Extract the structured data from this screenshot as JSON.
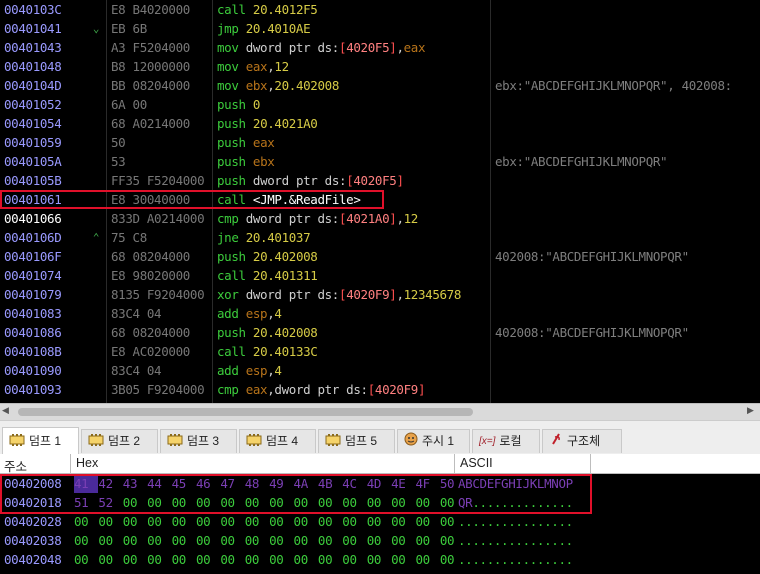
{
  "disasm": {
    "rows": [
      {
        "addr": "0040103C",
        "arrow": "",
        "bytes": "E8 B4020000",
        "instr": [
          {
            "t": "call ",
            "c": "t-mn"
          },
          {
            "t": "20.4012F5",
            "c": "t-num"
          }
        ],
        "comment": ""
      },
      {
        "addr": "00401041",
        "arrow": "⌄",
        "bytes": "EB 6B",
        "instr": [
          {
            "t": "jmp ",
            "c": "t-mn"
          },
          {
            "t": "20.4010AE",
            "c": "t-num"
          }
        ],
        "comment": ""
      },
      {
        "addr": "00401043",
        "arrow": "",
        "bytes": "A3 F5204000",
        "instr": [
          {
            "t": "mov ",
            "c": "t-mn"
          },
          {
            "t": "dword ptr ds:",
            "c": "t-kw"
          },
          {
            "t": "[",
            "c": "t-br"
          },
          {
            "t": "4020F5",
            "c": "t-lbl"
          },
          {
            "t": "]",
            "c": "t-br"
          },
          {
            "t": ",",
            "c": "t-kw"
          },
          {
            "t": "eax",
            "c": "t-reg"
          }
        ],
        "comment": ""
      },
      {
        "addr": "00401048",
        "arrow": "",
        "bytes": "B8 12000000",
        "instr": [
          {
            "t": "mov ",
            "c": "t-mn"
          },
          {
            "t": "eax",
            "c": "t-reg"
          },
          {
            "t": ",",
            "c": "t-kw"
          },
          {
            "t": "12",
            "c": "t-num"
          }
        ],
        "comment": ""
      },
      {
        "addr": "0040104D",
        "arrow": "",
        "bytes": "BB 08204000",
        "instr": [
          {
            "t": "mov ",
            "c": "t-mn"
          },
          {
            "t": "ebx",
            "c": "t-reg"
          },
          {
            "t": ",",
            "c": "t-kw"
          },
          {
            "t": "20.402008",
            "c": "t-num"
          }
        ],
        "comment": "ebx:\"ABCDEFGHIJKLMNOPQR\", 402008:"
      },
      {
        "addr": "00401052",
        "arrow": "",
        "bytes": "6A 00",
        "instr": [
          {
            "t": "push ",
            "c": "t-mn"
          },
          {
            "t": "0",
            "c": "t-num"
          }
        ],
        "comment": ""
      },
      {
        "addr": "00401054",
        "arrow": "",
        "bytes": "68 A0214000",
        "instr": [
          {
            "t": "push ",
            "c": "t-mn"
          },
          {
            "t": "20.4021A0",
            "c": "t-num"
          }
        ],
        "comment": ""
      },
      {
        "addr": "00401059",
        "arrow": "",
        "bytes": "50",
        "instr": [
          {
            "t": "push ",
            "c": "t-mn"
          },
          {
            "t": "eax",
            "c": "t-reg"
          }
        ],
        "comment": ""
      },
      {
        "addr": "0040105A",
        "arrow": "",
        "bytes": "53",
        "instr": [
          {
            "t": "push ",
            "c": "t-mn"
          },
          {
            "t": "ebx",
            "c": "t-reg"
          }
        ],
        "comment": "ebx:\"ABCDEFGHIJKLMNOPQR\""
      },
      {
        "addr": "0040105B",
        "arrow": "",
        "bytes": "FF35 F5204000",
        "instr": [
          {
            "t": "push ",
            "c": "t-mn"
          },
          {
            "t": "dword ptr ds:",
            "c": "t-kw"
          },
          {
            "t": "[",
            "c": "t-br"
          },
          {
            "t": "4020F5",
            "c": "t-lbl"
          },
          {
            "t": "]",
            "c": "t-br"
          }
        ],
        "comment": ""
      },
      {
        "addr": "00401061",
        "arrow": "",
        "bytes": "E8 30040000",
        "instr": [
          {
            "t": "call ",
            "c": "t-mn"
          },
          {
            "t": "<JMP.&ReadFile>",
            "c": "t-api"
          }
        ],
        "comment": "",
        "boxed": true
      },
      {
        "addr": "00401066",
        "arrow": "",
        "bytes": "833D A0214000",
        "instr": [
          {
            "t": "cmp ",
            "c": "t-mn"
          },
          {
            "t": "dword ptr ds:",
            "c": "t-kw"
          },
          {
            "t": "[",
            "c": "t-br"
          },
          {
            "t": "4021A0",
            "c": "t-lbl"
          },
          {
            "t": "]",
            "c": "t-br"
          },
          {
            "t": ",",
            "c": "t-kw"
          },
          {
            "t": "12",
            "c": "t-num"
          }
        ],
        "comment": "",
        "selected": true
      },
      {
        "addr": "0040106D",
        "arrow": "⌃",
        "bytes": "75 C8",
        "instr": [
          {
            "t": "jne ",
            "c": "t-mn"
          },
          {
            "t": "20.401037",
            "c": "t-num"
          }
        ],
        "comment": ""
      },
      {
        "addr": "0040106F",
        "arrow": "",
        "bytes": "68 08204000",
        "instr": [
          {
            "t": "push ",
            "c": "t-mn"
          },
          {
            "t": "20.402008",
            "c": "t-num"
          }
        ],
        "comment": "402008:\"ABCDEFGHIJKLMNOPQR\""
      },
      {
        "addr": "00401074",
        "arrow": "",
        "bytes": "E8 98020000",
        "instr": [
          {
            "t": "call ",
            "c": "t-mn"
          },
          {
            "t": "20.401311",
            "c": "t-num"
          }
        ],
        "comment": ""
      },
      {
        "addr": "00401079",
        "arrow": "",
        "bytes": "8135 F9204000",
        "instr": [
          {
            "t": "xor ",
            "c": "t-mn"
          },
          {
            "t": "dword ptr ds:",
            "c": "t-kw"
          },
          {
            "t": "[",
            "c": "t-br"
          },
          {
            "t": "4020F9",
            "c": "t-lbl"
          },
          {
            "t": "]",
            "c": "t-br"
          },
          {
            "t": ",",
            "c": "t-kw"
          },
          {
            "t": "12345678",
            "c": "t-num"
          }
        ],
        "comment": ""
      },
      {
        "addr": "00401083",
        "arrow": "",
        "bytes": "83C4 04",
        "instr": [
          {
            "t": "add ",
            "c": "t-mn"
          },
          {
            "t": "esp",
            "c": "t-reg"
          },
          {
            "t": ",",
            "c": "t-kw"
          },
          {
            "t": "4",
            "c": "t-num"
          }
        ],
        "comment": ""
      },
      {
        "addr": "00401086",
        "arrow": "",
        "bytes": "68 08204000",
        "instr": [
          {
            "t": "push ",
            "c": "t-mn"
          },
          {
            "t": "20.402008",
            "c": "t-num"
          }
        ],
        "comment": "402008:\"ABCDEFGHIJKLMNOPQR\""
      },
      {
        "addr": "0040108B",
        "arrow": "",
        "bytes": "E8 AC020000",
        "instr": [
          {
            "t": "call ",
            "c": "t-mn"
          },
          {
            "t": "20.40133C",
            "c": "t-num"
          }
        ],
        "comment": ""
      },
      {
        "addr": "00401090",
        "arrow": "",
        "bytes": "83C4 04",
        "instr": [
          {
            "t": "add ",
            "c": "t-mn"
          },
          {
            "t": "esp",
            "c": "t-reg"
          },
          {
            "t": ",",
            "c": "t-kw"
          },
          {
            "t": "4",
            "c": "t-num"
          }
        ],
        "comment": ""
      },
      {
        "addr": "00401093",
        "arrow": "",
        "bytes": "3B05 F9204000",
        "instr": [
          {
            "t": "cmp ",
            "c": "t-mn"
          },
          {
            "t": "eax",
            "c": "t-reg"
          },
          {
            "t": ",",
            "c": "t-kw"
          },
          {
            "t": "dword ptr ds:",
            "c": "t-kw"
          },
          {
            "t": "[",
            "c": "t-br"
          },
          {
            "t": "4020F9",
            "c": "t-lbl"
          },
          {
            "t": "]",
            "c": "t-br"
          }
        ],
        "comment": ""
      }
    ]
  },
  "tabs": [
    {
      "label": "덤프 1",
      "icon": "memory-dump-icon",
      "active": true
    },
    {
      "label": "덤프 2",
      "icon": "memory-dump-icon"
    },
    {
      "label": "덤프 3",
      "icon": "memory-dump-icon"
    },
    {
      "label": "덤프 4",
      "icon": "memory-dump-icon"
    },
    {
      "label": "덤프 5",
      "icon": "memory-dump-icon"
    },
    {
      "label": "주시 1",
      "icon": "watch-icon"
    },
    {
      "label": "로컬",
      "icon": "locals-icon",
      "icon_text": "[x=]"
    },
    {
      "label": "구조체",
      "icon": "struct-icon"
    }
  ],
  "dump": {
    "headers": {
      "address": "주소",
      "hex": "Hex",
      "ascii": "ASCII"
    },
    "rows": [
      {
        "addr": "00402008",
        "hex": [
          "41",
          "42",
          "43",
          "44",
          "45",
          "46",
          "47",
          "48",
          "49",
          "4A",
          "4B",
          "4C",
          "4D",
          "4E",
          "4F",
          "50"
        ],
        "ascii": "ABCDEFGHIJKLMNOP",
        "highlight": true
      },
      {
        "addr": "00402018",
        "hex": [
          "51",
          "52",
          "00",
          "00",
          "00",
          "00",
          "00",
          "00",
          "00",
          "00",
          "00",
          "00",
          "00",
          "00",
          "00",
          "00"
        ],
        "ascii": "QR..............",
        "highlight": true,
        "hl_count": 2
      },
      {
        "addr": "00402028",
        "hex": [
          "00",
          "00",
          "00",
          "00",
          "00",
          "00",
          "00",
          "00",
          "00",
          "00",
          "00",
          "00",
          "00",
          "00",
          "00",
          "00"
        ],
        "ascii": "................"
      },
      {
        "addr": "00402038",
        "hex": [
          "00",
          "00",
          "00",
          "00",
          "00",
          "00",
          "00",
          "00",
          "00",
          "00",
          "00",
          "00",
          "00",
          "00",
          "00",
          "00"
        ],
        "ascii": "................"
      },
      {
        "addr": "00402048",
        "hex": [
          "00",
          "00",
          "00",
          "00",
          "00",
          "00",
          "00",
          "00",
          "00",
          "00",
          "00",
          "00",
          "00",
          "00",
          "00",
          "00"
        ],
        "ascii": "................"
      }
    ]
  },
  "colors": {
    "highlight_box": "#e0102a",
    "mnemonic": "#3ccc3c",
    "address": "#9a9aff"
  }
}
